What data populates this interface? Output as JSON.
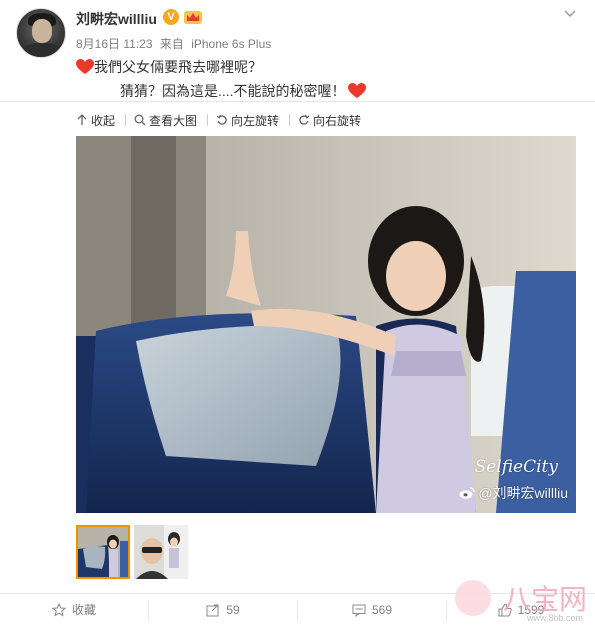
{
  "post": {
    "username": "刘畊宏willliu",
    "verified_badge": "V",
    "date": "8月16日 11:23",
    "source_prefix": "来自",
    "source": "iPhone 6s Plus",
    "text_line1": "我們父女倆要飛去哪裡呢？",
    "text_line2": "猜猜？因為這是....不能說的秘密喔！"
  },
  "toolbar": {
    "collapse": "收起",
    "view_large": "查看大图",
    "rotate_left": "向左旋转",
    "rotate_right": "向右旋转"
  },
  "photo": {
    "watermark_app": "SelfieCity",
    "watermark_user": "@刘畊宏willliu"
  },
  "thumbnails": [
    {
      "selected": true
    },
    {
      "selected": false
    }
  ],
  "actions": {
    "favorite": "收藏",
    "repost_count": "59",
    "comment_count": "569",
    "like_count": "1599"
  },
  "site_watermark": {
    "name": "八宝网",
    "url": "www.8bb.com"
  },
  "colors": {
    "accent": "#f29100",
    "heart": "#e8392b",
    "badge": "#f5a623"
  },
  "icons": [
    "chevron-down-icon",
    "heart-icon",
    "collapse-arrow-icon",
    "magnifier-icon",
    "rotate-left-icon",
    "rotate-right-icon",
    "star-icon",
    "repost-icon",
    "comment-icon",
    "like-icon",
    "weibo-icon",
    "crown-icon"
  ]
}
